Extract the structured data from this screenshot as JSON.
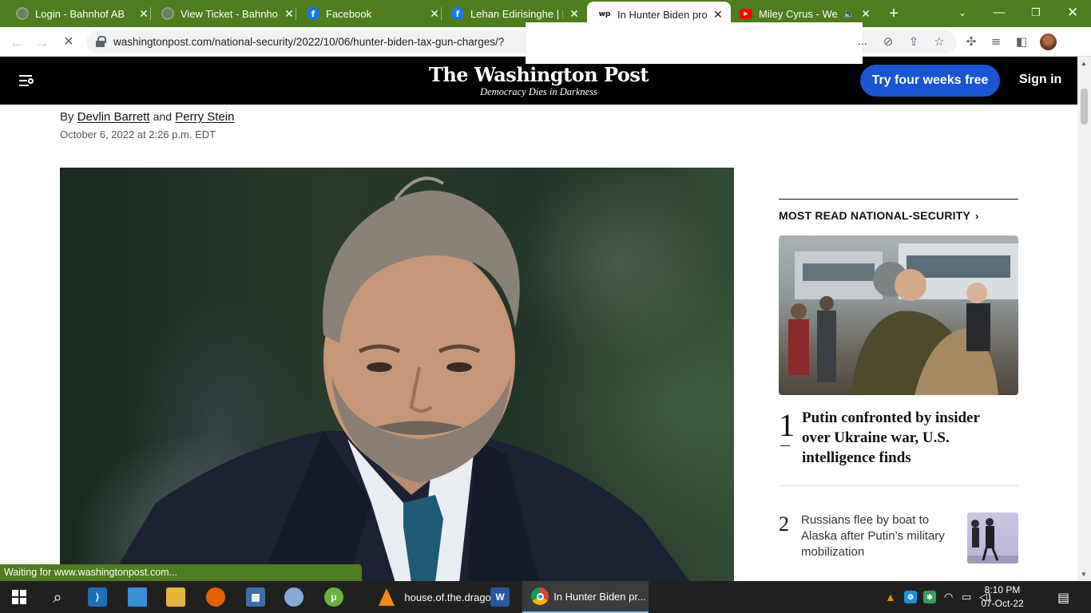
{
  "browser": {
    "tabs": [
      {
        "title": "Login - Bahnhof AB",
        "favicon": "globe-icon"
      },
      {
        "title": "View Ticket - Bahnhof",
        "favicon": "globe-icon"
      },
      {
        "title": "Facebook",
        "favicon": "facebook-icon"
      },
      {
        "title": "Lehan Edirisinghe | Fac",
        "favicon": "facebook-icon"
      },
      {
        "title": "In Hunter Biden probe",
        "favicon": "wp-icon",
        "active": true
      },
      {
        "title": "Miley Cyrus - We",
        "favicon": "youtube-icon",
        "audio": true
      }
    ],
    "url": "washingtonpost.com/national-security/2022/10/06/hunter-biden-tax-gun-charges/?",
    "url_suffix": "...",
    "tab_bar_color": "#4f7c1e"
  },
  "site": {
    "logo": "The Washington Post",
    "tagline": "Democracy Dies in Darkness",
    "cta": "Try four weeks free",
    "sign_in": "Sign in",
    "accent": "#1955d4"
  },
  "article": {
    "by": "By",
    "and": "and",
    "author1": "Devlin Barrett",
    "author2": "Perry Stein",
    "date": "October 6, 2022 at 2:26 p.m. EDT"
  },
  "sidebar": {
    "heading": "MOST READ NATIONAL-SECURITY",
    "items": [
      {
        "rank": "1",
        "headline": "Putin confronted by insider over Ukraine war, U.S. intelligence finds"
      },
      {
        "rank": "2",
        "headline": "Russians flee by boat to Alaska after Putin’s military mobilization"
      }
    ]
  },
  "status_bar": "Waiting for www.washingtonpost.com...",
  "taskbar": {
    "apps": [
      {
        "label": "house.of.the.drago...",
        "icon": "vlc-icon"
      },
      {
        "label": "In Hunter Biden pr...",
        "icon": "chrome-icon",
        "active": true
      }
    ],
    "time": "8:10 PM",
    "date": "07-Oct-22"
  }
}
